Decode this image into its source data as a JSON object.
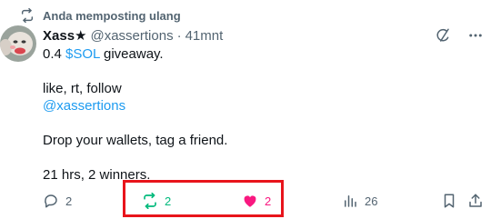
{
  "repost_context": {
    "text": "Anda memposting ulang",
    "icon": "repost-icon"
  },
  "tweet": {
    "author_name": "Xass★",
    "handle": "@xassertions",
    "separator": "·",
    "time": "41mnt",
    "lines": {
      "l1_prefix": "0.4 ",
      "l1_cashtag": "$SOL",
      "l1_suffix": " giveaway.",
      "l2": "like, rt, follow",
      "l3_mention": "@xassertions",
      "l4": "Drop your wallets, tag a friend.",
      "l5": "21 hrs, 2 winners."
    }
  },
  "header_icons": [
    "grok-icon",
    "more-icon"
  ],
  "actions": {
    "reply_count": "2",
    "repost_count": "2",
    "like_count": "2",
    "views_count": "26"
  },
  "colors": {
    "text": "#0f1419",
    "secondary": "#536471",
    "link": "#1d9bf0",
    "repost_active": "#00ba7c",
    "like_active": "#f91880",
    "highlight": "#e8141b"
  }
}
